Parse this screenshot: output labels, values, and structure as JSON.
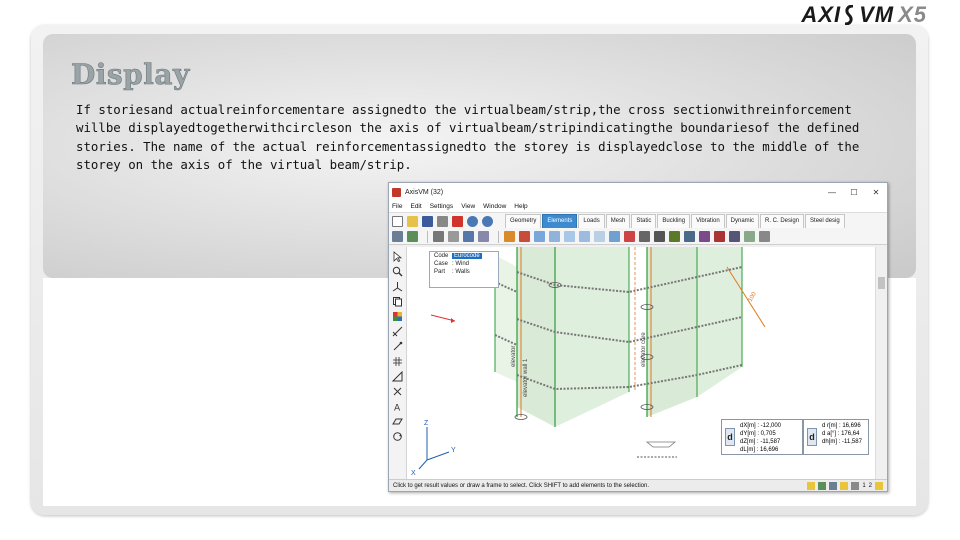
{
  "slide": {
    "title": "Display",
    "body_lines": [
      "If storiesand actualreinforcementare assignedto the virtualbeam/strip,the cross sectionwithreinforcement",
      "willbe displayedtogetherwithcircleson the axis of virtualbeam/stripindicatingthe boundariesof the defined",
      "stories. The name of the actual reinforcementassignedto the storey is displayedclose to the middle of the",
      "storey on the axis of the virtual beam/strip."
    ]
  },
  "logo": {
    "text_left": "AXI",
    "text_right": "VM",
    "version": "X5"
  },
  "app": {
    "window_title": "AxisVM (32)",
    "window_buttons": [
      "—",
      "☐",
      "✕"
    ],
    "menu": [
      "File",
      "Edit",
      "Settings",
      "View",
      "Window",
      "Help"
    ],
    "tabs": [
      "Geometry",
      "Elements",
      "Loads",
      "Mesh",
      "Static",
      "Buckling",
      "Vibration",
      "Dynamic",
      "R. C. Design",
      "Steel desig"
    ],
    "active_tab": "Elements",
    "info": {
      "code_label": "Code",
      "code_value": "Eurocode",
      "case_label": "Case",
      "case_value": ": Wind",
      "part_label": "Part",
      "part_value": ": Walls"
    },
    "result_left": [
      "dX[m] : -12,000",
      "dY[m] : 0,705",
      "dZ[m] : -11,587",
      "dL[m] : 16,696"
    ],
    "result_right": [
      "d r[m] : 16,696",
      "d a[°] : 176,64",
      "dh[m] : -11,587"
    ],
    "result_symbol": "d",
    "viewport_labels": {
      "elevator_wall": "elevator wall 1",
      "elevator_core": "elevator core",
      "elevator": "elevator",
      "dim_label": "100"
    },
    "axes": {
      "z": "Z",
      "y": "Y",
      "x": "X"
    },
    "status_text": "Click to get result values or draw a frame to select. Click SHIFT to add elements to the selection.",
    "status_numbers": [
      "1",
      "2"
    ],
    "colors": {
      "active_tab": "#3c8bd0",
      "wall_fill": "#cfe6cc",
      "beam_orange": "#e07a1f",
      "grid_green": "#2e9b3a"
    }
  }
}
